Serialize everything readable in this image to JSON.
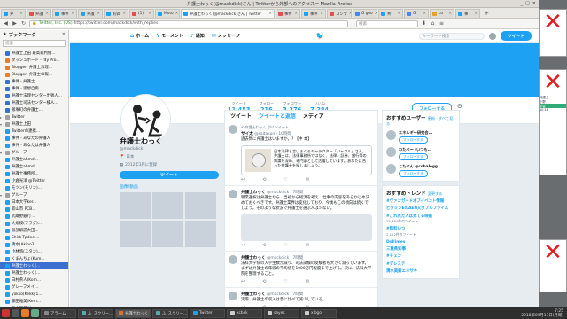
{
  "window": {
    "title": "弁護士わっく(@mackdick)さん | Twitterから外部へのアクセス一 Mozilla Firefox"
  },
  "tabs": [
    {
      "label": "弁",
      "color": "#1da1f2"
    },
    {
      "label": "弁護",
      "color": "#e05050"
    },
    {
      "label": "事件",
      "color": "#1da1f2"
    },
    {
      "label": "弁護",
      "color": "#1da1f2"
    },
    {
      "label": "有価",
      "color": "#1da1f2"
    },
    {
      "label": "(1)",
      "color": "#e05050"
    },
    {
      "label": "Moto",
      "color": "#1da1f2"
    },
    {
      "label": "弁護士わっく(@mackdick)さん | Twitter",
      "color": "#1da1f2",
      "active": true
    },
    {
      "label": "事件",
      "color": "#e05050"
    },
    {
      "label": "事件",
      "color": "#1da1f2"
    },
    {
      "label": "コンテ",
      "color": "#e05050"
    },
    {
      "label": "G goo",
      "color": "#4285f4"
    },
    {
      "label": "共",
      "color": "#1da1f2"
    },
    {
      "label": "G ",
      "color": "#4285f4"
    },
    {
      "label": "co",
      "color": "#e8a030"
    },
    {
      "label": "事",
      "color": "#1da1f2"
    }
  ],
  "navbar": {
    "site_identity": "Twitter, Inc. (US)",
    "url": "https://twitter.com/mackdick/with_replies",
    "search_placeholder": "検索"
  },
  "sidebar": {
    "title": "ブックマーク",
    "search_placeholder": "検索",
    "items": [
      {
        "label": "弁護士上田 最高裁判例...",
        "arrow": "",
        "color": "#3b6fd0"
      },
      {
        "label": "ダッシュボード - fdy Pro...",
        "arrow": "",
        "color": "#e08030"
      },
      {
        "label": "Blogger: 弁護士法理...",
        "arrow": "",
        "color": "#e08030"
      },
      {
        "label": "Blogger: 弁護士の報...",
        "arrow": "",
        "color": "#e08030"
      },
      {
        "label": "事件 - 弁護士...",
        "arrow": "",
        "color": "#3b6fd0"
      },
      {
        "label": "事件 - 思想自衛...",
        "arrow": "",
        "color": "#3b6fd0"
      },
      {
        "label": "弁護士法理センター出張人...",
        "arrow": "",
        "color": "#3b6fd0"
      },
      {
        "label": "弁護士司法センター検人...",
        "arrow": "",
        "color": "#3b6fd0"
      },
      {
        "label": "飯塚町の弁護士...",
        "arrow": "",
        "color": "#3b6fd0"
      },
      {
        "label": "Twitter",
        "arrow": "▸",
        "color": "#a0a0a0"
      },
      {
        "label": "弁護士上田",
        "arrow": "▾",
        "color": "#a0a0a0"
      },
      {
        "label": "Twitterの連携...",
        "arrow": "",
        "color": "#1da1f2"
      },
      {
        "label": "事件 - あなたの弁護人",
        "arrow": "",
        "color": "#1da1f2"
      },
      {
        "label": "事件 - あなたは弁護人",
        "arrow": "",
        "color": "#1da1f2"
      },
      {
        "label": "グループ",
        "arrow": "▾",
        "color": "#a0a0a0"
      },
      {
        "label": "弁護士ahmd...",
        "arrow": "",
        "color": "#1da1f2"
      },
      {
        "label": "弁護士ahmd...",
        "arrow": "",
        "color": "#1da1f2"
      },
      {
        "label": "弁護士事務所...",
        "arrow": "",
        "color": "#1da1f2"
      },
      {
        "label": "小倉光洋 @Twitter",
        "arrow": "",
        "color": "#1da1f2"
      },
      {
        "label": "モツン(モリン)...",
        "arrow": "",
        "color": "#1da1f2"
      },
      {
        "label": "グループ",
        "arrow": "▾",
        "color": "#a0a0a0"
      },
      {
        "label": "日本大学ker...",
        "arrow": "",
        "color": "#1da1f2"
      },
      {
        "label": "新山市 PCB...",
        "arrow": "",
        "color": "#1da1f2"
      },
      {
        "label": "武蔵野銀行 ...",
        "arrow": "",
        "color": "#1da1f2"
      },
      {
        "label": "大規模(フラグ)...",
        "arrow": "",
        "color": "#1da1f2"
      },
      {
        "label": "仮部解説大田...",
        "arrow": "",
        "color": "#1da1f2"
      },
      {
        "label": "Shirk-Tpdeel...",
        "arrow": "",
        "color": "#1da1f2"
      },
      {
        "label": "清水(Akino2...",
        "arrow": "",
        "color": "#1da1f2"
      },
      {
        "label": "小林悠(スタン)...",
        "arrow": "",
        "color": "#1da1f2"
      },
      {
        "label": "くまんちょ(Kum...",
        "arrow": "",
        "color": "#1da1f2"
      },
      {
        "label": "弁護士わっく(...",
        "arrow": "",
        "color": "#1da1f2",
        "selected": true
      },
      {
        "label": "弁護士わっく(...",
        "arrow": "",
        "color": "#1da1f2"
      },
      {
        "label": "白村県人(Kom...",
        "arrow": "",
        "color": "#1da1f2"
      },
      {
        "label": "グレーフメイ...",
        "arrow": "",
        "color": "#1da1f2"
      },
      {
        "label": "yokko(Kekky1...",
        "arrow": "",
        "color": "#1da1f2"
      },
      {
        "label": "藤田雅美(Kem...",
        "arrow": "",
        "color": "#1da1f2"
      },
      {
        "label": "鈴木朝日(Kum...",
        "arrow": "",
        "color": "#1da1f2"
      },
      {
        "label": "佐藤(Monte...",
        "arrow": "",
        "color": "#1da1f2"
      },
      {
        "label": "田原(ハンチェ...",
        "arrow": "",
        "color": "#1da1f2"
      },
      {
        "label": "山田(fame...",
        "arrow": "",
        "color": "#1da1f2"
      }
    ]
  },
  "twitter_nav": {
    "home": "ホーム",
    "moments": "モーメント",
    "notifications": "通知",
    "messages": "メッセージ",
    "search_placeholder": "キーワード検索",
    "tweet_button": "ツイート"
  },
  "profile": {
    "name": "弁護士わっく",
    "handle": "@mackdick",
    "location": "日本",
    "joined": "2012年3月に登録",
    "tweet_button": "ツイート",
    "media_header": "画像/動画",
    "stats": [
      {
        "label": "ツイート",
        "value": "11,453"
      },
      {
        "label": "フォロー",
        "value": "216"
      },
      {
        "label": "フォロワー",
        "value": "3,376"
      },
      {
        "label": "いいね",
        "value": "7,284"
      }
    ],
    "follow_button": "フォローする"
  },
  "timeline": {
    "tabs": [
      "ツイート",
      "ツイートと返信",
      "メディア"
    ],
    "active_tab": 1,
    "tweets": [
      {
        "retweeted": "弁護士わっく がリツイート",
        "author": "サイ太",
        "handle": "@saitakun · 10時間",
        "text": "過去問に弁護士はいますか。? 【中 本】",
        "quote": "日本法律と言いまくるキャラクター「ジャフル」さん。弁護士は、法律事務所ではなく、法律、証券、銀行等の知識を深め、専門家として活躍しています。あなたに合った弁護士を探しましょう。"
      },
      {
        "retweeted": "",
        "author": "弁護士わっく",
        "handle": "@mackdick · 7時間",
        "text": "職業選択は弁護士なら、当初から経済を考え、仕事の内容をあらかじめ決めておくべきです。弁護士業界は変化しており、今後もこの傾向は続くでしょう。そのような状況で弁護士を選ぶ人は少ない。",
        "quote": ""
      },
      {
        "retweeted": "",
        "author": "弁護士わっく",
        "handle": "@mackdick · 7時間",
        "text": "法科大学院の入学生数が減り、司法試験の受験者も大きく減っています。まずは弁護士の年収の平均値を1000万円程度まで上げる。次に、法科大学院を整理すること。",
        "quote": ""
      },
      {
        "retweeted": "",
        "author": "弁護士わっく",
        "handle": "@mackdick · 7時間",
        "text": "実際、弁護士の収入は昔に比べて減少している。",
        "quote": ""
      }
    ]
  },
  "recommended": {
    "title": "おすすめユーザー",
    "refresh": "更新 · すべて見る",
    "users": [
      {
        "name": "エネルギー研究会...",
        "follow": "フォローする"
      },
      {
        "name": "わたべー (いつも... ",
        "follow": "フォローする"
      },
      {
        "name": "こたべん @cobalogg...",
        "follow": "フォローする"
      }
    ]
  },
  "trends": {
    "title": "おすすめトレンド",
    "change": "変更する",
    "items": [
      {
        "name": "#ヴァンガードオブイベント情報",
        "count": ""
      },
      {
        "name": "ビタミンEのAEN又ダブルプライム",
        "count": ""
      },
      {
        "name": "#これ見た人は見てる映画",
        "count": "25,384件のツイート"
      },
      {
        "name": "#無料いつ",
        "count": "2,112件のツイート"
      },
      {
        "name": "Dollimes",
        "count": ""
      },
      {
        "name": "三重県知事",
        "count": ""
      },
      {
        "name": "#チェン",
        "count": ""
      },
      {
        "name": "#デレステ",
        "count": ""
      },
      {
        "name": "清水美鈴エネサキ",
        "count": ""
      }
    ]
  },
  "desktop_right": {
    "labels": [
      "弁護士",
      "小野",
      "学習",
      "10:18"
    ]
  },
  "taskbar": {
    "items": [
      {
        "label": "アラーム",
        "color": "#888"
      },
      {
        "label": "ふ_スクリー...",
        "color": "#5aa"
      },
      {
        "label": "弁護士わっく",
        "color": "#e07030",
        "active": true
      },
      {
        "label": "ふ_スクリー...",
        "color": "#5aa"
      },
      {
        "label": "Twitter",
        "color": "#1da1f2"
      },
      {
        "label": "xcbck",
        "color": "#ccc"
      },
      {
        "label": "sayes",
        "color": "#ccc"
      },
      {
        "label": "xlogo",
        "color": "#ccc"
      }
    ],
    "time": "7:25",
    "date": "2018年09月17日(月曜)"
  }
}
